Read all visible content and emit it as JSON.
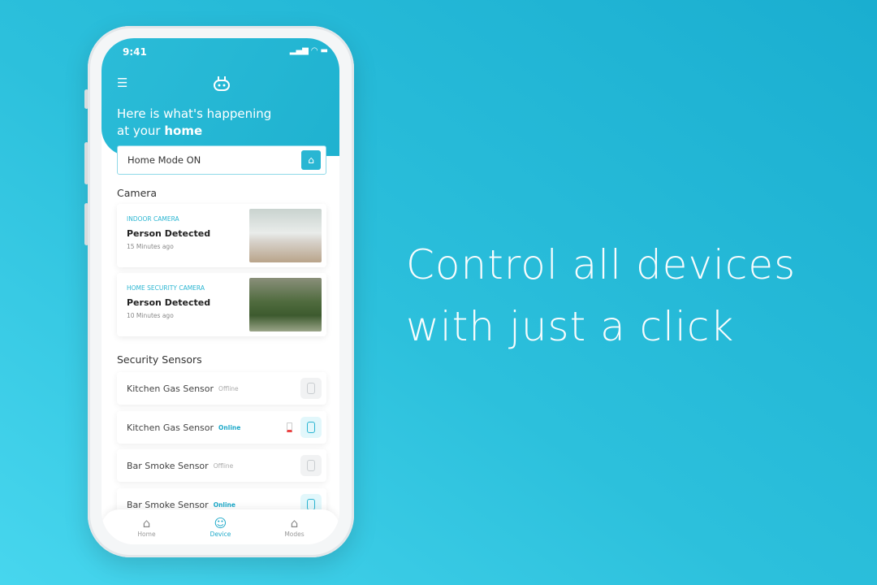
{
  "status": {
    "time": "9:41",
    "signal": "▂▄▆",
    "wifi": "◠",
    "battery": "▬"
  },
  "header": {
    "menu_icon": "☰",
    "logo_icon": "robot-icon",
    "greeting": "Here is what's happening",
    "greeting2_prefix": "at your ",
    "greeting2_bold": "home"
  },
  "mode": {
    "label": "Home Mode ON",
    "icon": "⌂"
  },
  "camera": {
    "title": "Camera",
    "items": [
      {
        "type": "INDOOR CAMERA",
        "event": "Person Detected",
        "time": "15 Minutes ago"
      },
      {
        "type": "HOME SECURITY CAMERA",
        "event": "Person Detected",
        "time": "10 Minutes ago"
      }
    ]
  },
  "sensors": {
    "title": "Security Sensors",
    "items": [
      {
        "name": "Kitchen Gas Sensor",
        "status": "Offline"
      },
      {
        "name": "Kitchen Gas Sensor",
        "status": "Online",
        "low_battery": true
      },
      {
        "name": "Bar Smoke Sensor",
        "status": "Offline"
      },
      {
        "name": "Bar Smoke Sensor",
        "status": "Online"
      }
    ]
  },
  "nav": [
    {
      "label": "Home",
      "icon": "⌂"
    },
    {
      "label": "Device",
      "icon": "☺"
    },
    {
      "label": "Modes",
      "icon": "⌂"
    }
  ],
  "tagline": {
    "line1": "Control all devices",
    "line2": "with just a click"
  },
  "colors": {
    "accent": "#29b6d3",
    "background": "#2cc0dc"
  }
}
